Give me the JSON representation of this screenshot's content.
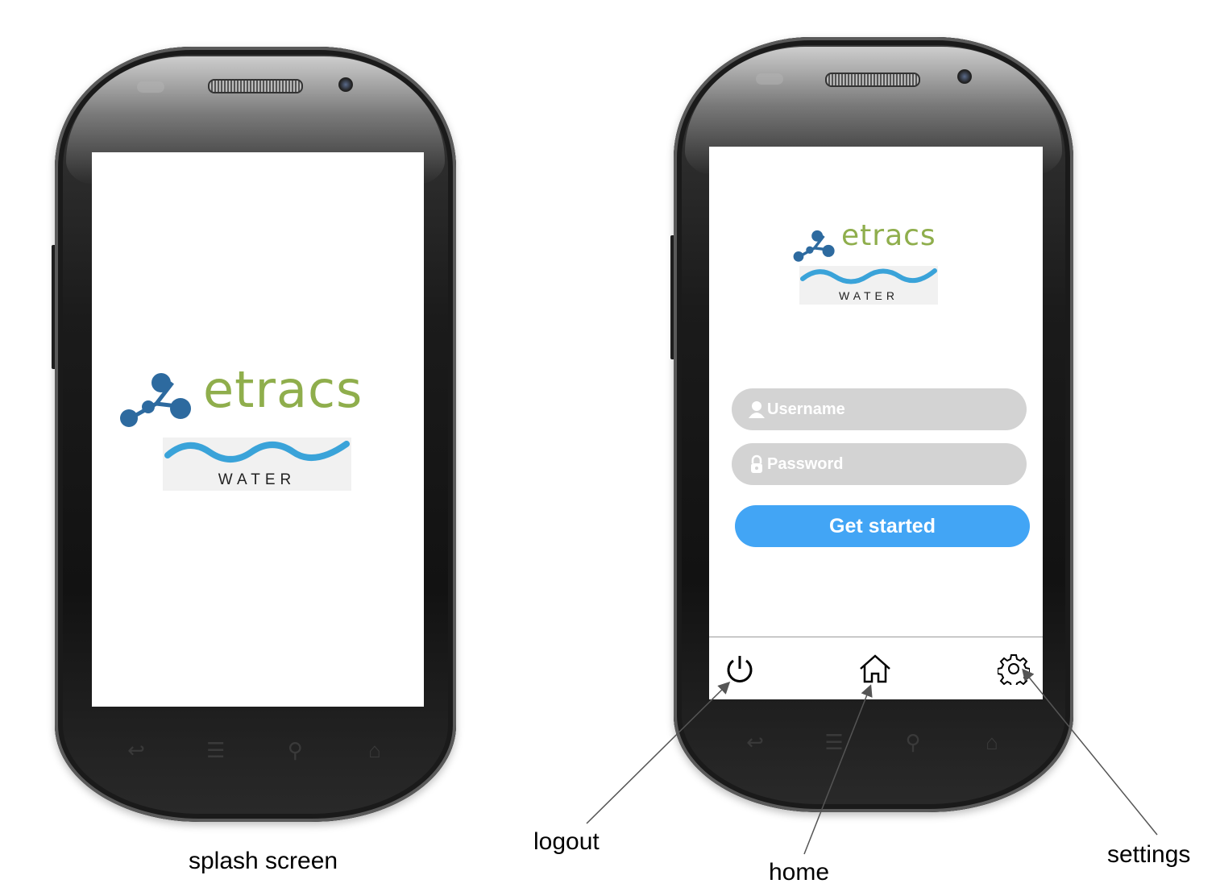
{
  "splash": {
    "brand": "etracs",
    "subbrand": "WATER",
    "caption": "splash screen"
  },
  "login": {
    "brand": "etracs",
    "subbrand": "WATER",
    "username_placeholder": "Username",
    "password_placeholder": "Password",
    "submit_label": "Get started"
  },
  "tabbar": {
    "items": [
      {
        "icon": "power-icon",
        "label": "logout"
      },
      {
        "icon": "home-icon",
        "label": "home"
      },
      {
        "icon": "gear-icon",
        "label": "settings"
      }
    ]
  },
  "colors": {
    "brand_blue": "#2d6a9f",
    "brand_green": "#8fae4c",
    "wave_blue": "#3aa3d9",
    "button_blue": "#42a5f5",
    "field_gray": "#d3d3d3"
  }
}
